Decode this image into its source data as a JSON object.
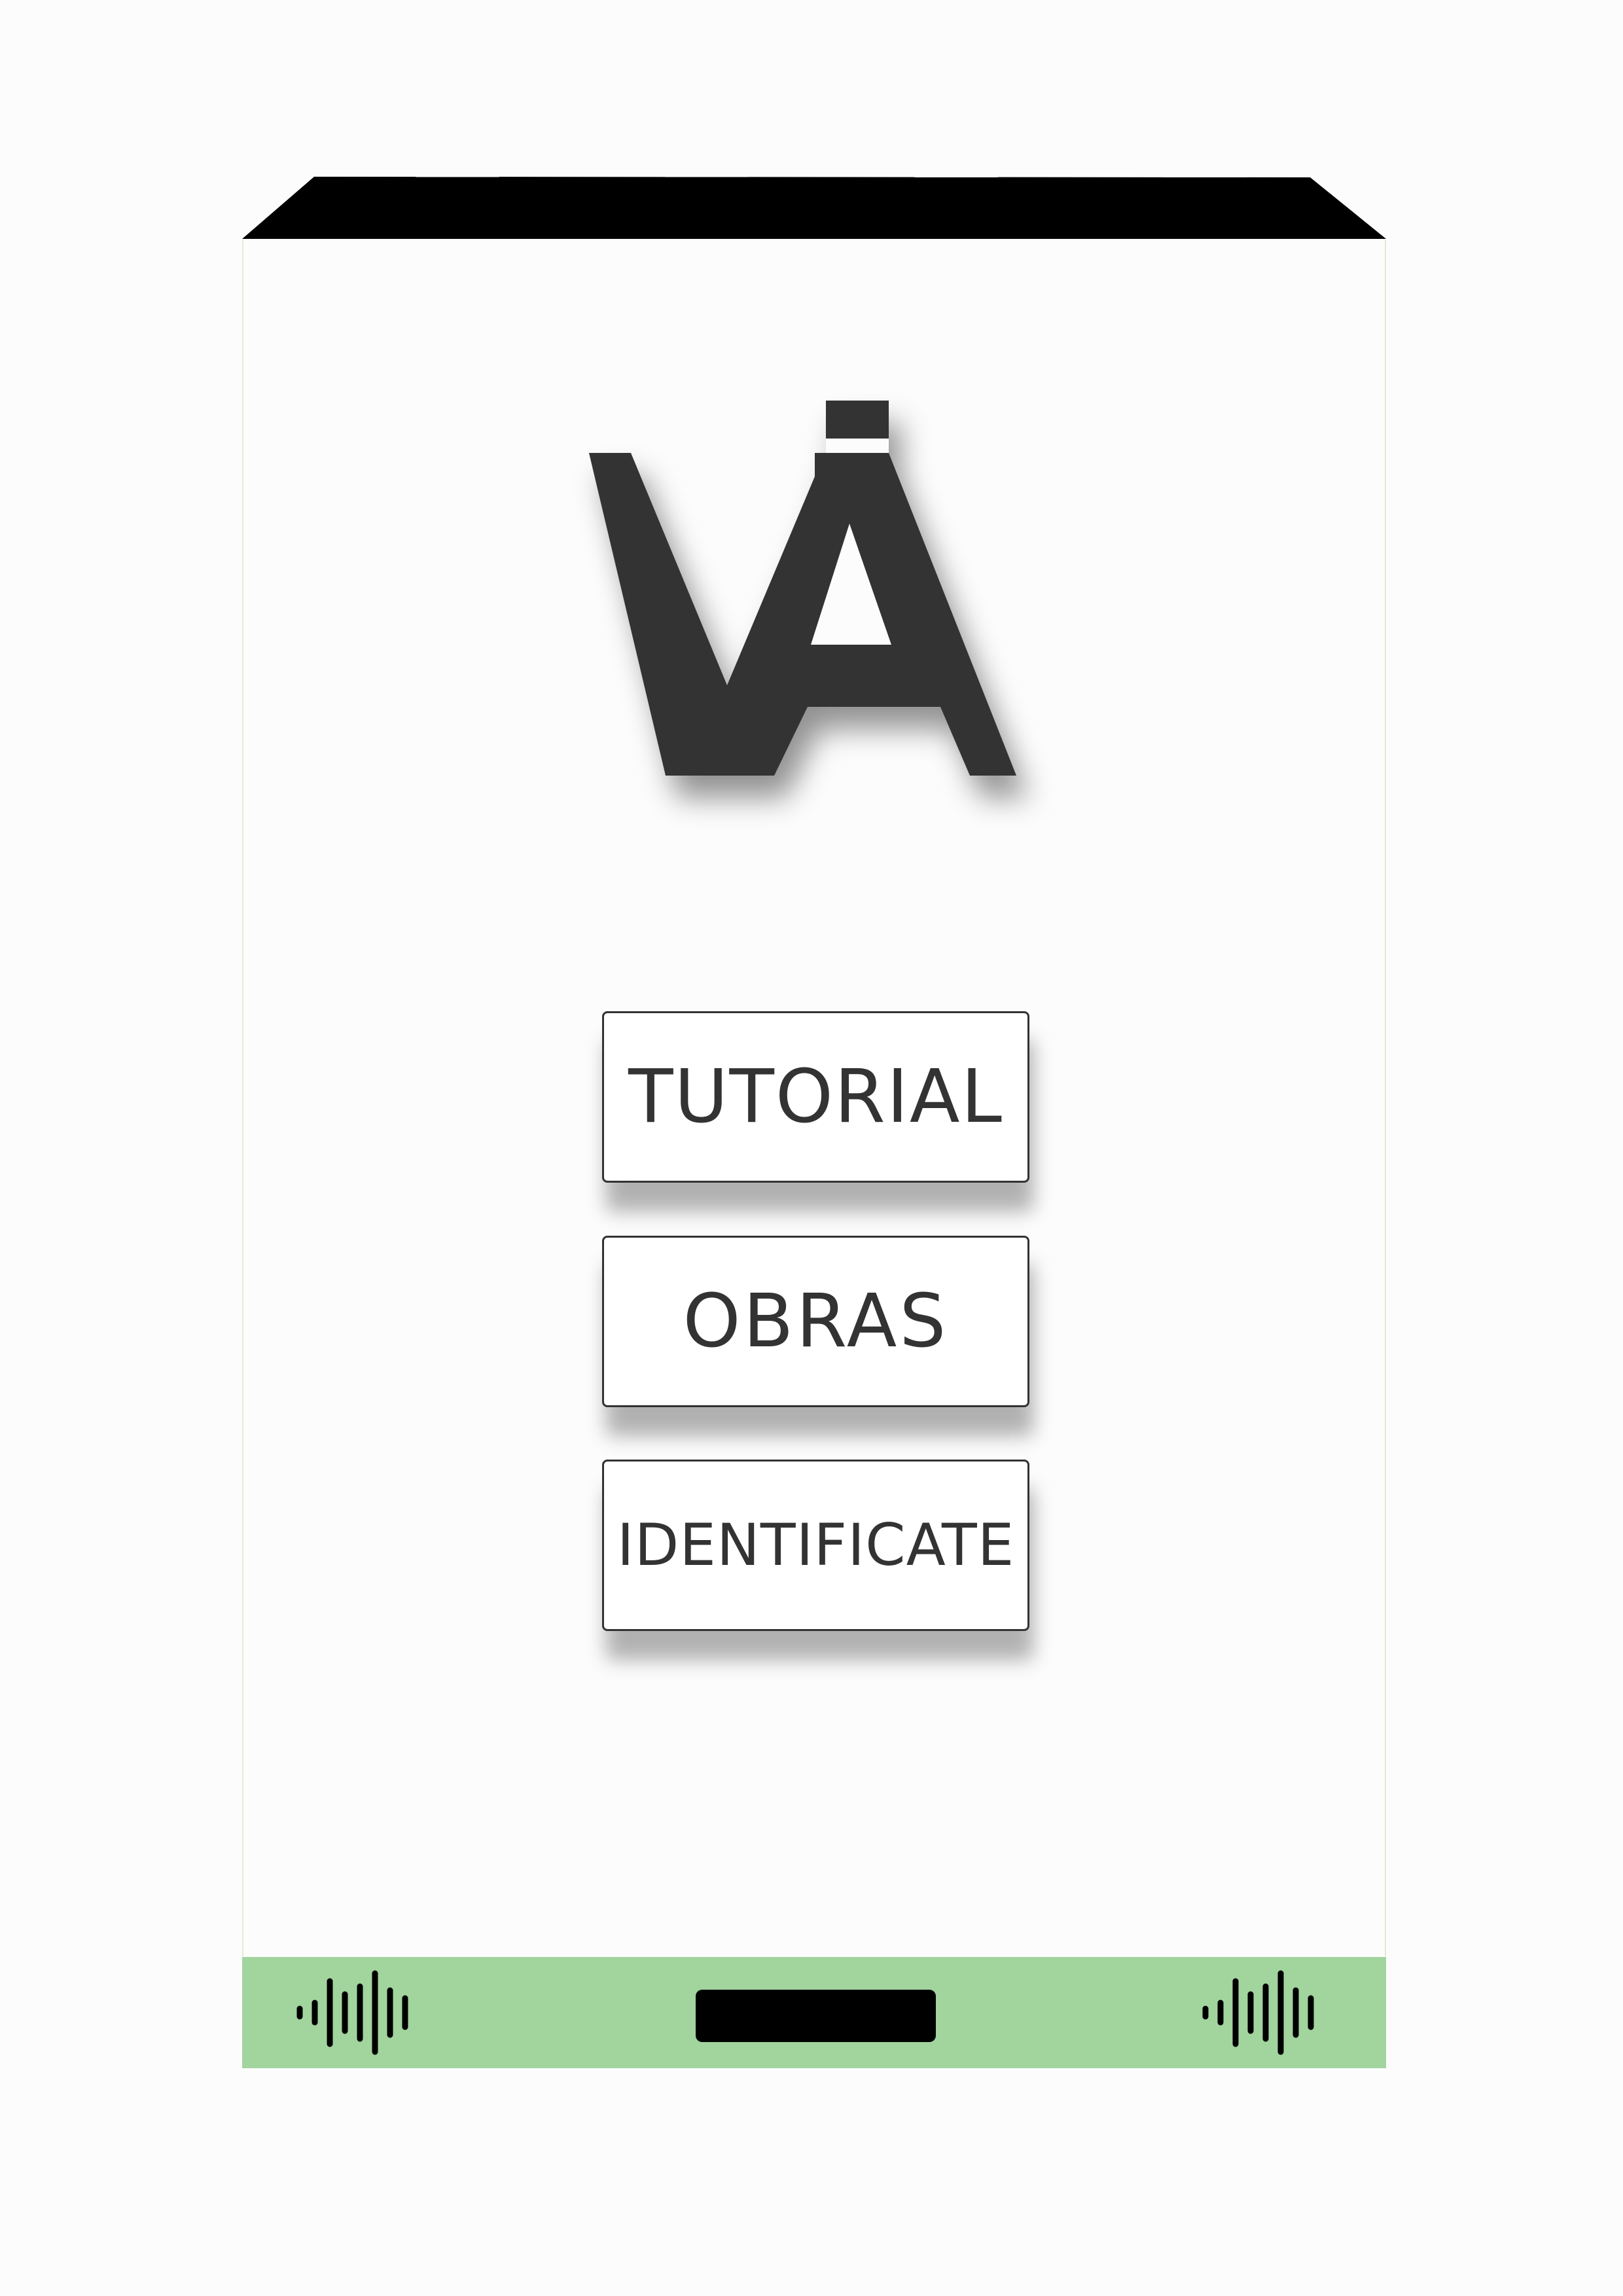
{
  "screen": {
    "logo": {
      "name": "va-logo",
      "color": "#333333"
    },
    "menu": {
      "tutorial_label": "TUTORIAL",
      "obras_label": "OBRAS",
      "identificate_label": "IDENTIFICATE"
    },
    "bottom_bar": {
      "background": "#a2d49e",
      "left_icon": "audio-waveform-icon",
      "right_icon": "audio-waveform-icon",
      "center_button": "home-bar"
    }
  },
  "colors": {
    "bezel": "#000000",
    "text": "#333333",
    "bottom_bar": "#a2d49e",
    "screen": "#fcfcfc"
  }
}
